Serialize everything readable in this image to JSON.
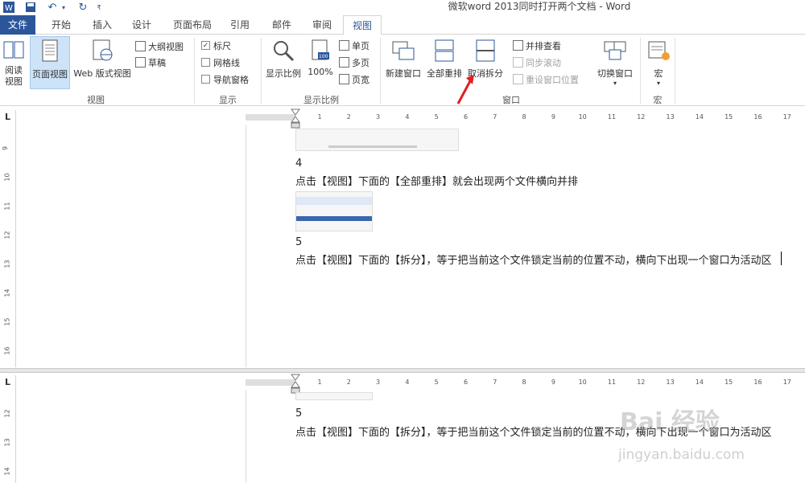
{
  "window": {
    "title": "微软word 2013同时打开两个文档 - Word"
  },
  "tabs": [
    "文件",
    "开始",
    "插入",
    "设计",
    "页面布局",
    "引用",
    "邮件",
    "审阅",
    "视图"
  ],
  "ribbon": {
    "views": {
      "label": "视图",
      "read_mode": "阅读视图",
      "print_layout": "页面视图",
      "web_layout": "Web 版式视图",
      "outline": "大纲视图",
      "draft": "草稿"
    },
    "show": {
      "label": "显示",
      "ruler": "标尺",
      "ruler_checked": true,
      "gridlines": "网格线",
      "gridlines_checked": false,
      "nav_pane": "导航窗格",
      "nav_pane_checked": false
    },
    "zoom": {
      "label": "显示比例",
      "zoom": "显示比例",
      "hundred": "100%",
      "one_page": "单页",
      "multi_page": "多页",
      "page_width": "页宽"
    },
    "window": {
      "label": "窗口",
      "new_window": "新建窗口",
      "arrange_all": "全部重排",
      "remove_split": "取消拆分",
      "side_by_side": "并排查看",
      "sync_scroll": "同步滚动",
      "reset_pos": "重设窗口位置",
      "switch": "切换窗口"
    },
    "macros": {
      "label": "宏",
      "macros": "宏"
    }
  },
  "ruler_ticks": [
    "1",
    "2",
    "3",
    "4",
    "5",
    "6",
    "7",
    "8",
    "9",
    "10",
    "11",
    "12",
    "13",
    "14",
    "15",
    "16",
    "17"
  ],
  "vruler_top": [
    "9",
    "10",
    "11",
    "12",
    "13",
    "14",
    "15",
    "16"
  ],
  "vruler_bottom": [
    "12",
    "13",
    "14"
  ],
  "document": {
    "top": {
      "step4_num": "4",
      "step4_text": "点击【视图】下面的【全部重排】就会出现两个文件横向并排",
      "step5_num": "5",
      "step5_text": "点击【视图】下面的【拆分】，等于把当前这个文件锁定当前的位置不动，横向下出现一个窗口为活动区"
    },
    "bottom": {
      "step5_num": "5",
      "step5_text": "点击【视图】下面的【拆分】，等于把当前这个文件锁定当前的位置不动，横向下出现一个窗口为活动区"
    }
  },
  "watermark": {
    "logo": "Bai 经验",
    "url": "jingyan.baidu.com"
  },
  "colors": {
    "brand": "#2b579a",
    "selected": "#cde3f7",
    "arrow": "#e02020"
  }
}
